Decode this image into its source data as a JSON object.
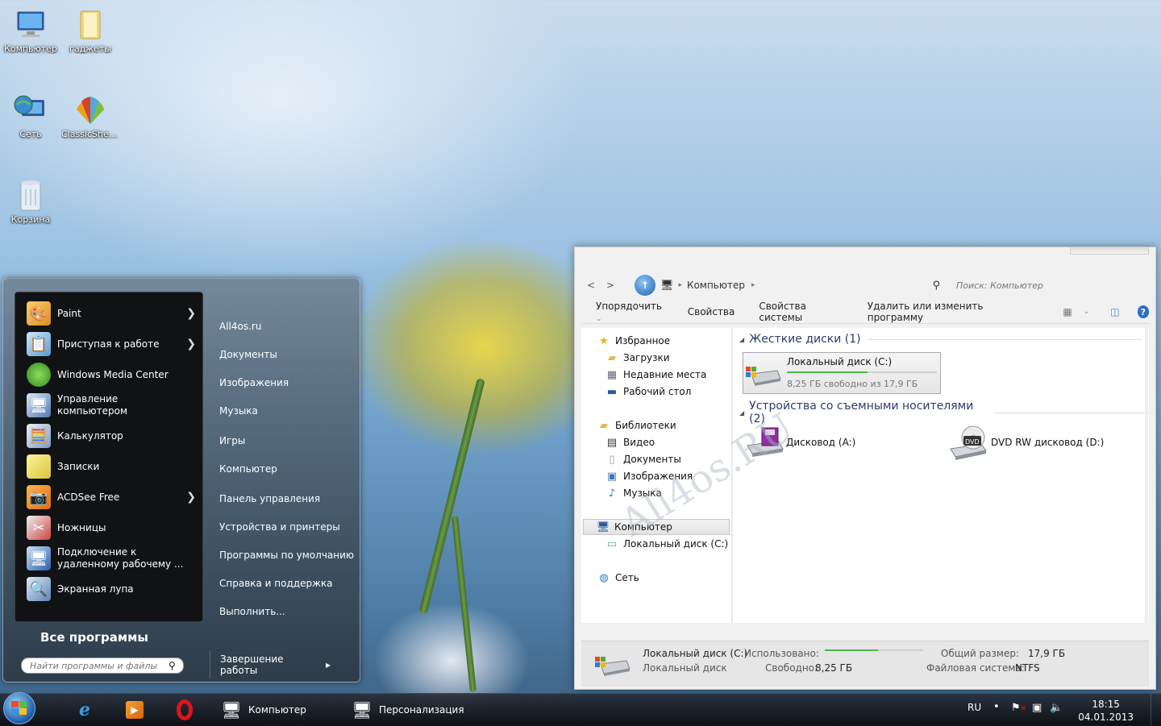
{
  "desktop": {
    "icons": [
      {
        "label": "Компьютер",
        "icon": "computer-icon"
      },
      {
        "label": "гаджеты",
        "icon": "folder-icon"
      },
      {
        "label": "Сеть",
        "icon": "network-icon"
      },
      {
        "label": "ClassicShel...",
        "icon": "classic-shell-icon"
      },
      {
        "label": "Корзина",
        "icon": "recycle-bin-icon"
      }
    ],
    "watermark": "All4os.RU"
  },
  "start_menu": {
    "programs": [
      {
        "label": "Paint",
        "has_submenu": true
      },
      {
        "label": "Приступая к работе",
        "has_submenu": true
      },
      {
        "label": "Windows Media Center",
        "has_submenu": false
      },
      {
        "label": "Управление\nкомпьютером",
        "has_submenu": false
      },
      {
        "label": "Калькулятор",
        "has_submenu": false
      },
      {
        "label": "Записки",
        "has_submenu": false
      },
      {
        "label": "ACDSee Free",
        "has_submenu": true
      },
      {
        "label": "Ножницы",
        "has_submenu": false
      },
      {
        "label": "Подключение к\nудаленному рабочему ...",
        "has_submenu": false
      },
      {
        "label": "Экранная лупа",
        "has_submenu": false
      }
    ],
    "right_items": [
      "All4os.ru",
      "Документы",
      "Изображения",
      "Музыка",
      "Игры",
      "Компьютер",
      "Панель управления",
      "Устройства и принтеры",
      "Программы по умолчанию",
      "Справка и поддержка",
      "Выполнить..."
    ],
    "all_programs": "Все программы",
    "search_placeholder": "Найти программы и файлы",
    "shutdown_label": "Завершение работы",
    "shutdown_arrow": "▸"
  },
  "explorer": {
    "nav_back": "<",
    "nav_forward": ">",
    "breadcrumb": "Компьютер",
    "breadcrumb_sep": "▸",
    "search_placeholder": "Поиск: Компьютер",
    "toolbar": {
      "organize": "Упорядочить",
      "properties": "Свойства",
      "system_properties": "Свойства системы",
      "uninstall": "Удалить или изменить программу"
    },
    "nav": {
      "favorites": "Избранное",
      "downloads": "Загрузки",
      "recent": "Недавние места",
      "desktop": "Рабочий стол",
      "libraries": "Библиотеки",
      "video": "Видео",
      "documents": "Документы",
      "pictures": "Изображения",
      "music": "Музыка",
      "computer": "Компьютер",
      "local_disk": "Локальный диск (C:)",
      "network": "Сеть"
    },
    "groups": {
      "hard_drives": "Жесткие диски (1)",
      "removable": "Устройства со съемными носителями (2)"
    },
    "drive_c": {
      "name": "Локальный диск (C:)",
      "free_text": "8,25 ГБ свободно из 17,9 ГБ",
      "used_fraction": 0.54
    },
    "drive_a": "Дисковод (A:)",
    "drive_d": "DVD RW дисковод (D:)",
    "status": {
      "name": "Локальный диск (C:)",
      "type": "Локальный диск",
      "used_label": "Использовано:",
      "free_label": "Свободно:",
      "free_value": "8,25 ГБ",
      "total_label": "Общий размер:",
      "total_value": "17,9 ГБ",
      "fs_label": "Файловая система:",
      "fs_value": "NTFS"
    }
  },
  "taskbar": {
    "buttons": [
      {
        "label": "Компьютер"
      },
      {
        "label": "Персонализация"
      }
    ],
    "lang": "RU",
    "time": "18:15",
    "date": "04.01.2013"
  }
}
